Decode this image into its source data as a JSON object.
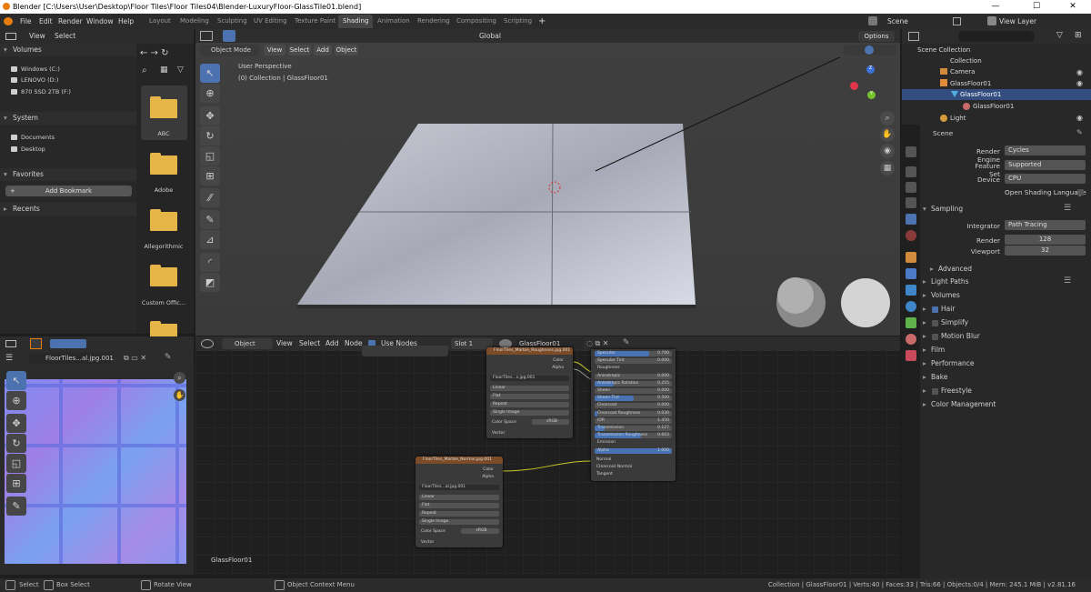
{
  "window": {
    "title": "Blender [C:\\Users\\User\\Desktop\\Floor Tiles\\Floor Tiles04\\Blender-LuxuryFloor-GlassTile01.blend]",
    "minimize": "—",
    "maximize": "☐",
    "close": "✕"
  },
  "menu": [
    "File",
    "Edit",
    "Render",
    "Window",
    "Help"
  ],
  "workspaces": [
    "Layout",
    "Modeling",
    "Sculpting",
    "UV Editing",
    "Texture Paint",
    "Shading",
    "Animation",
    "Rendering",
    "Compositing",
    "Scripting"
  ],
  "active_workspace": "Shading",
  "scene_label": "Scene",
  "viewlayer_label": "View Layer",
  "filebrowser": {
    "view": "View",
    "select": "Select",
    "volumes_title": "Volumes",
    "volumes": [
      "Windows (C:)",
      "LENOVO (D:)",
      "870 SSD 2TB (F:)"
    ],
    "system_title": "System",
    "system": [
      "Documents",
      "Desktop"
    ],
    "favorites_title": "Favorites",
    "add_bookmark": "Add Bookmark",
    "recents_title": "Recents",
    "folders": [
      "ABC",
      "Adobe",
      "Allegorithmic",
      "Custom Offic..."
    ]
  },
  "viewport": {
    "mode": "Object Mode",
    "view": "View",
    "select": "Select",
    "add": "Add",
    "object": "Object",
    "orientation": "Global",
    "options": "Options",
    "info_line1": "User Perspective",
    "info_line2": "(0) Collection | GlassFloor01",
    "axis_x": "X",
    "axis_y": "Y",
    "axis_z": "Z"
  },
  "image_editor": {
    "image_name": "FloorTiles...al.jpg.001"
  },
  "node_editor": {
    "object": "Object",
    "view": "View",
    "select": "Select",
    "add": "Add",
    "node": "Node",
    "use_nodes": "Use Nodes",
    "slot": "Slot 1",
    "material": "GlassFloor01",
    "footer_label": "GlassFloor01",
    "node1": {
      "title": "FloorTiles_Marble_Roughness.jpg.001",
      "outputs": [
        "Color",
        "Alpha"
      ],
      "image": "FloorTiles...s.jpg.001",
      "opts": [
        "Linear",
        "Flat",
        "Repeat",
        "Single Image"
      ],
      "colorspace_label": "Color Space",
      "colorspace": "sRGB",
      "vector": "Vector"
    },
    "node2": {
      "title": "FloorTiles_Marble_Normal.jpg.001",
      "outputs": [
        "Color",
        "Alpha"
      ],
      "image": "FloorTiles...al.jpg.001",
      "opts": [
        "Linear",
        "Flat",
        "Repeat",
        "Single Image"
      ],
      "colorspace_label": "Color Space",
      "colorspace": "sRGB",
      "vector": "Vector"
    },
    "bsdf": {
      "rows": [
        [
          "Specular",
          "0.700"
        ],
        [
          "Specular Tint",
          "0.000"
        ],
        [
          "Roughness",
          ""
        ],
        [
          "Anisotropic",
          "0.000"
        ],
        [
          "Anisotropic Rotation",
          "0.255"
        ],
        [
          "Sheen",
          "0.000"
        ],
        [
          "Sheen Tint",
          "0.500"
        ],
        [
          "Clearcoat",
          "0.000"
        ],
        [
          "Clearcoat Roughness",
          "0.030"
        ],
        [
          "IOR",
          "1.450"
        ],
        [
          "Transmission",
          "0.127"
        ],
        [
          "Transmission Roughness",
          "0.603"
        ],
        [
          "Emission",
          ""
        ],
        [
          "Alpha",
          "1.000"
        ]
      ],
      "inputs": [
        "Normal",
        "Clearcoat Normal",
        "Tangent"
      ]
    }
  },
  "outliner": {
    "title": "Scene Collection",
    "items": [
      "Collection",
      "Camera",
      "GlassFloor01",
      "GlassFloor01",
      "GlassFloor01",
      "Light"
    ]
  },
  "properties": {
    "context": "Scene",
    "render_engine_label": "Render Engine",
    "render_engine": "Cycles",
    "feature_set_label": "Feature Set",
    "feature_set": "Supported",
    "device_label": "Device",
    "device": "CPU",
    "osl_label": "Open Shading Language",
    "sampling": "Sampling",
    "integrator_label": "Integrator",
    "integrator": "Path Tracing",
    "render_label": "Render",
    "render_val": "128",
    "viewport_label": "Viewport",
    "viewport_val": "32",
    "advanced": "Advanced",
    "sections": [
      "Light Paths",
      "Volumes",
      "Hair",
      "Simplify",
      "Motion Blur",
      "Film",
      "Performance",
      "Bake",
      "Freestyle",
      "Color Management"
    ]
  },
  "status": {
    "select": "Select",
    "box_select": "Box Select",
    "rotate": "Rotate View",
    "ctx": "Object Context Menu",
    "info": "Collection | GlassFloor01 | Verts:40 | Faces:33 | Tris:66 | Objects:0/4 | Mem: 245.1 MiB | v2.81.16"
  }
}
